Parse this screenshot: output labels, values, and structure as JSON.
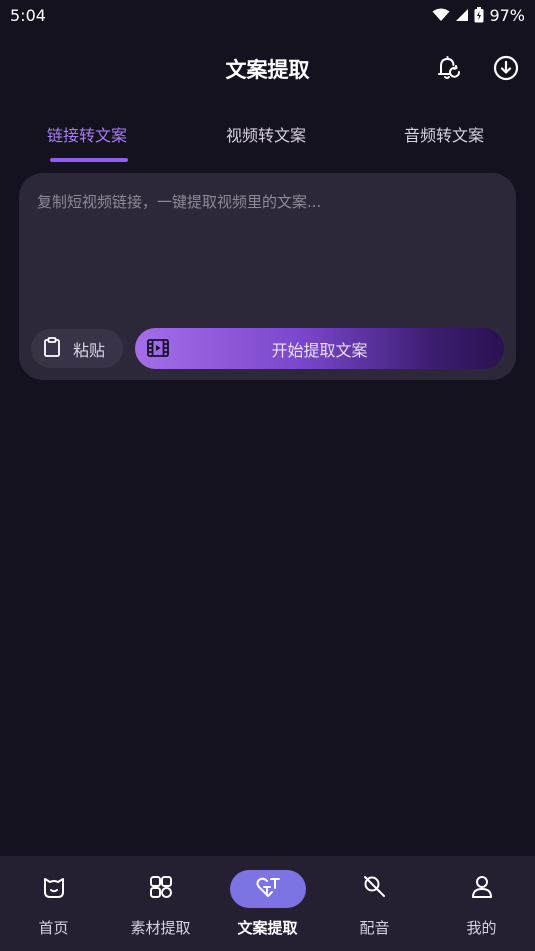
{
  "status_bar": {
    "time": "5:04",
    "battery": "97%"
  },
  "header": {
    "title": "文案提取",
    "icons": [
      "bell-refresh-icon",
      "download-circle-icon"
    ]
  },
  "tabs": [
    {
      "label": "链接转文案",
      "active": true
    },
    {
      "label": "视频转文案",
      "active": false
    },
    {
      "label": "音频转文案",
      "active": false
    }
  ],
  "input_card": {
    "placeholder": "复制短视频链接，一键提取视频里的文案...",
    "value": "",
    "paste_label": "粘贴",
    "extract_label": "开始提取文案"
  },
  "bottom_nav": [
    {
      "label": "首页",
      "icon": "home-icon",
      "active": false
    },
    {
      "label": "素材提取",
      "icon": "material-icon",
      "active": false
    },
    {
      "label": "文案提取",
      "icon": "text-extract-icon",
      "active": true
    },
    {
      "label": "配音",
      "icon": "dubbing-icon",
      "active": false
    },
    {
      "label": "我的",
      "icon": "profile-icon",
      "active": false
    }
  ],
  "colors": {
    "background": "#15121f",
    "accent": "#8d5ef0",
    "card": "#2c2839",
    "nav_active": "#7c74e2"
  }
}
